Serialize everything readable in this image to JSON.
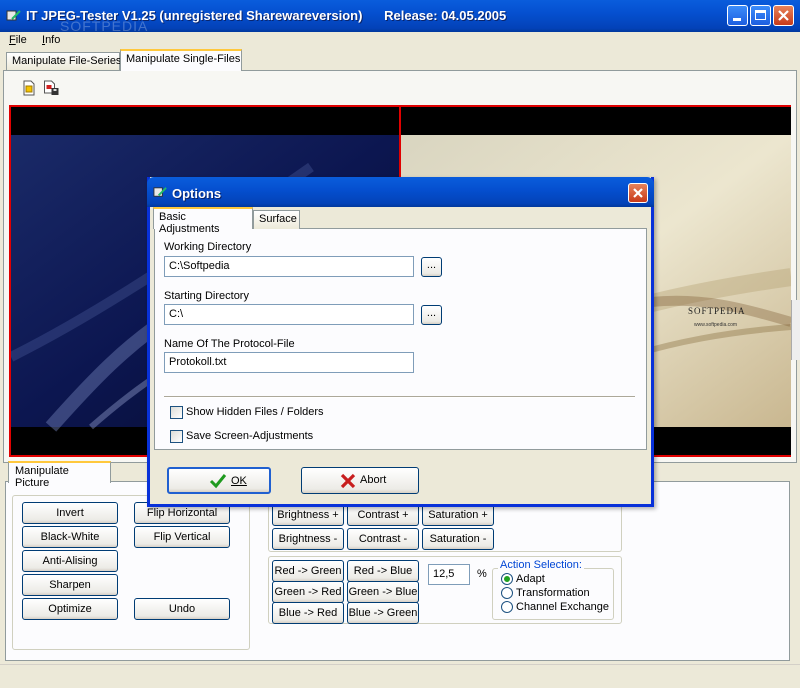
{
  "window": {
    "title": "IT JPEG-Tester V1.25 (unregistered Sharewareversion)      Release: 04.05.2005"
  },
  "menu": {
    "file": "File",
    "info": "Info"
  },
  "main_tabs": {
    "series": "Manipulate File-Series",
    "single": "Manipulate Single-Files"
  },
  "watermark": "SOFTPEDIA",
  "preview": {
    "brand": "SOFTPEDIA",
    "brand_sub": "www.softpedia.com"
  },
  "manipulate_tab": "Manipulate Picture",
  "buttons": {
    "invert": "Invert",
    "black_white": "Black-White",
    "anti_alising": "Anti-Alising",
    "sharpen": "Sharpen",
    "optimize": "Optimize",
    "flip_h": "Flip Horizontal",
    "flip_v": "Flip Vertical",
    "undo": "Undo",
    "brightness_plus": "Brightness +",
    "brightness_minus": "Brightness -",
    "contrast_plus": "Contrast +",
    "contrast_minus": "Contrast -",
    "saturation_plus": "Saturation +",
    "saturation_minus": "Saturation -",
    "red_green": "Red -> Green",
    "red_blue": "Red -> Blue",
    "green_red": "Green -> Red",
    "green_blue": "Green -> Blue",
    "blue_red": "Blue -> Red",
    "blue_green": "Blue -> Green"
  },
  "percent": {
    "value": "12,5",
    "unit": "%"
  },
  "action_selection": {
    "label": "Action Selection:",
    "options": [
      "Adapt",
      "Transformation",
      "Channel Exchange"
    ],
    "selected": "Adapt"
  },
  "dialog": {
    "title": "Options",
    "tabs": {
      "basic": "Basic Adjustments",
      "surface": "Surface"
    },
    "working_dir_label": "Working Directory",
    "working_dir_value": "C:\\Softpedia",
    "starting_dir_label": "Starting Directory",
    "starting_dir_value": "C:\\",
    "protocol_label": "Name Of The Protocol-File",
    "protocol_value": "Protokoll.txt",
    "browse": "...",
    "show_hidden": "Show Hidden Files / Folders",
    "save_screen": "Save Screen-Adjustments",
    "ok": "OK",
    "abort": "Abort"
  }
}
